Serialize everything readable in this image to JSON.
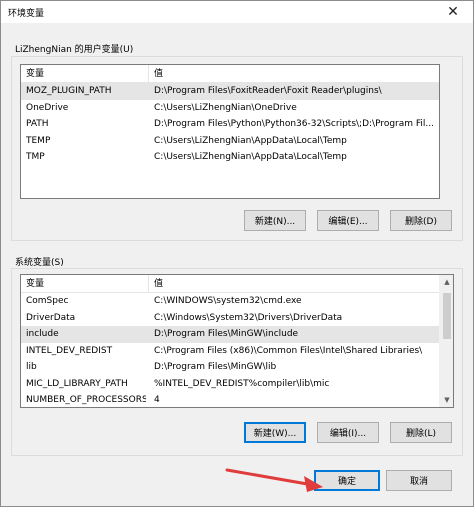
{
  "window": {
    "title": "环境变量",
    "close_glyph": "✕"
  },
  "user_vars": {
    "group_label": "LiZhengNian 的用户变量(U)",
    "headers": {
      "name": "变量",
      "value": "值"
    },
    "rows": [
      {
        "name": "MOZ_PLUGIN_PATH",
        "value": "D:\\Program Files\\FoxitReader\\Foxit Reader\\plugins\\"
      },
      {
        "name": "OneDrive",
        "value": "C:\\Users\\LiZhengNian\\OneDrive"
      },
      {
        "name": "PATH",
        "value": "D:\\Program Files\\Python\\Python36-32\\Scripts\\;D:\\Program Fil..."
      },
      {
        "name": "TEMP",
        "value": "C:\\Users\\LiZhengNian\\AppData\\Local\\Temp"
      },
      {
        "name": "TMP",
        "value": "C:\\Users\\LiZhengNian\\AppData\\Local\\Temp"
      }
    ],
    "selected_index": 0,
    "buttons": {
      "new": "新建(N)...",
      "edit": "编辑(E)...",
      "delete": "删除(D)"
    }
  },
  "system_vars": {
    "group_label": "系统变量(S)",
    "headers": {
      "name": "变量",
      "value": "值"
    },
    "rows": [
      {
        "name": "ComSpec",
        "value": "C:\\WINDOWS\\system32\\cmd.exe"
      },
      {
        "name": "DriverData",
        "value": "C:\\Windows\\System32\\Drivers\\DriverData"
      },
      {
        "name": "include",
        "value": "D:\\Program Files\\MinGW\\include"
      },
      {
        "name": "INTEL_DEV_REDIST",
        "value": "C:\\Program Files (x86)\\Common Files\\Intel\\Shared Libraries\\"
      },
      {
        "name": "lib",
        "value": "D:\\Program Files\\MinGW\\lib"
      },
      {
        "name": "MIC_LD_LIBRARY_PATH",
        "value": "%INTEL_DEV_REDIST%compiler\\lib\\mic"
      },
      {
        "name": "NUMBER_OF_PROCESSORS",
        "value": "4"
      }
    ],
    "selected_index": 2,
    "buttons": {
      "new": "新建(W)...",
      "edit": "编辑(I)...",
      "delete": "删除(L)"
    }
  },
  "footer": {
    "ok": "确定",
    "cancel": "取消"
  },
  "colors": {
    "annotation_arrow": "#e03c3c",
    "focus_border": "#0078d7"
  }
}
